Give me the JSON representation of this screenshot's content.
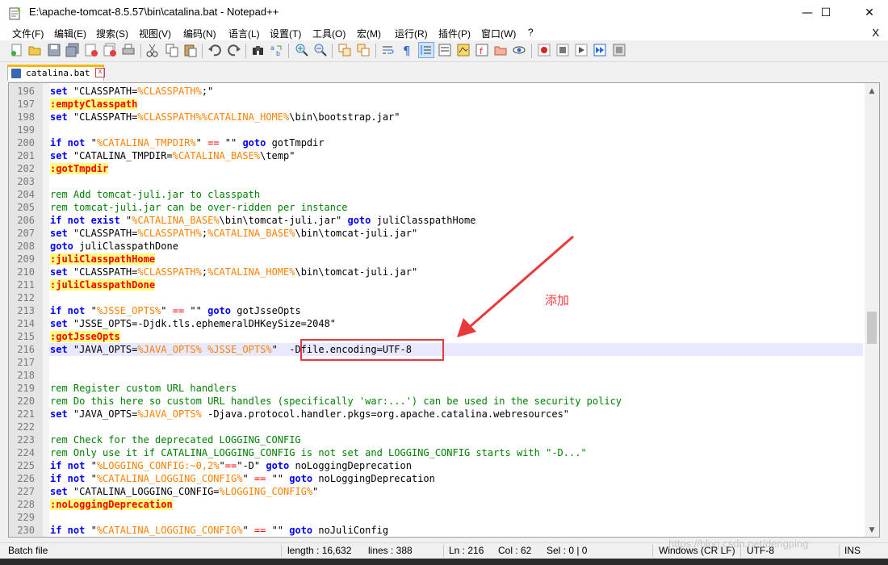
{
  "window": {
    "title": "E:\\apache-tomcat-8.5.57\\bin\\catalina.bat - Notepad++",
    "minimize": "—",
    "maximize": "☐",
    "close": "✕"
  },
  "menu": {
    "items": [
      "文件(F)",
      "编辑(E)",
      "搜索(S)",
      "视图(V)",
      "编码(N)",
      "语言(L)",
      "设置(T)",
      "工具(O)",
      "宏(M)",
      "运行(R)",
      "插件(P)",
      "窗口(W)",
      "?"
    ],
    "close": "X"
  },
  "tab": {
    "label": "catalina.bat",
    "close": "x"
  },
  "editor": {
    "first_line": 196,
    "current_line": 216,
    "lines": [
      "196",
      "197",
      "198",
      "199",
      "200",
      "201",
      "202",
      "203",
      "204",
      "205",
      "206",
      "207",
      "208",
      "209",
      "210",
      "211",
      "212",
      "213",
      "214",
      "215",
      "216",
      "217",
      "218",
      "219",
      "220",
      "221",
      "222",
      "223",
      "224",
      "225",
      "226",
      "227",
      "228",
      "229",
      "230"
    ]
  },
  "annotation": {
    "text": "添加"
  },
  "status": {
    "filetype": "Batch file",
    "length": "length : 16,632",
    "lines": "lines : 388",
    "ln": "Ln : 216",
    "col": "Col : 62",
    "sel": "Sel : 0 | 0",
    "eol": "Windows (CR LF)",
    "encoding": "UTF-8",
    "mode": "INS"
  },
  "watermark": "https://blog.csdn.net/dengping"
}
